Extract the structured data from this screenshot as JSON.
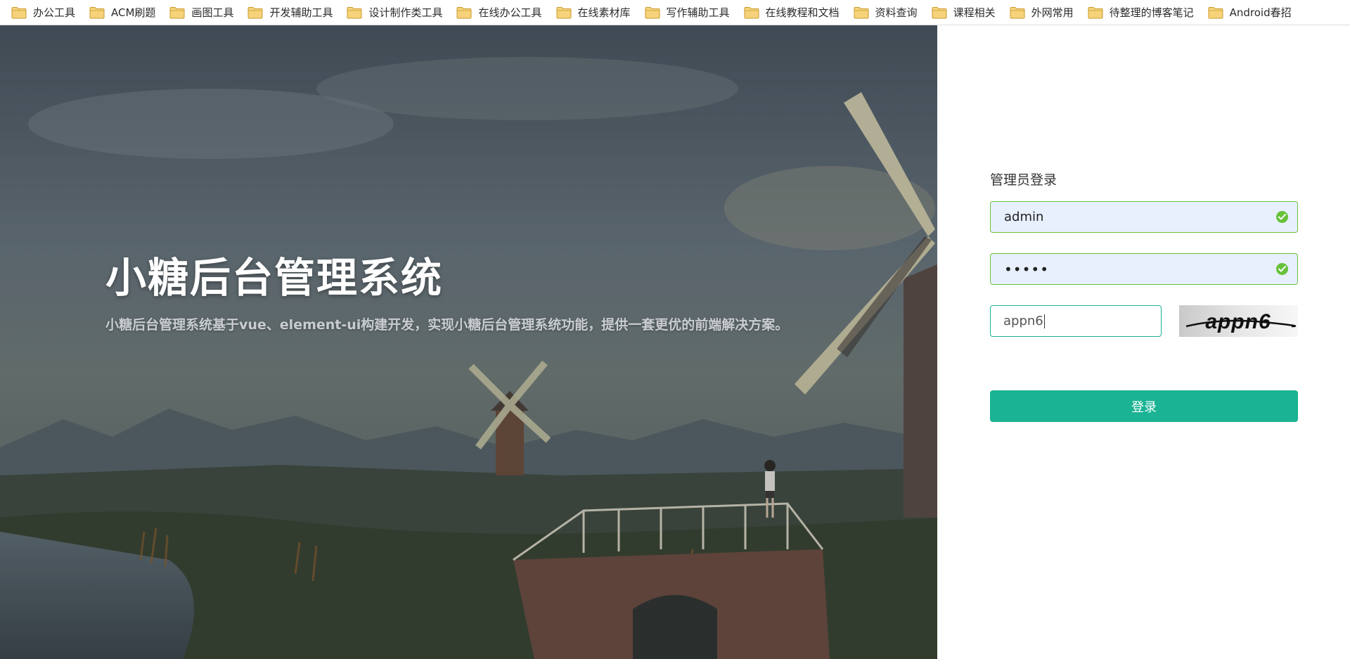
{
  "bookmarks": [
    {
      "label": "办公工具"
    },
    {
      "label": "ACM刷题"
    },
    {
      "label": "画图工具"
    },
    {
      "label": "开发辅助工具"
    },
    {
      "label": "设计制作类工具"
    },
    {
      "label": "在线办公工具"
    },
    {
      "label": "在线素材库"
    },
    {
      "label": "写作辅助工具"
    },
    {
      "label": "在线教程和文档"
    },
    {
      "label": "资料查询"
    },
    {
      "label": "课程相关"
    },
    {
      "label": "外网常用"
    },
    {
      "label": "待整理的博客笔记"
    },
    {
      "label": "Android春招"
    }
  ],
  "hero": {
    "title": "小糖后台管理系统",
    "description": "小糖后台管理系统基于vue、element-ui构建开发，实现小糖后台管理系统功能，提供一套更优的前端解决方案。"
  },
  "login": {
    "title": "管理员登录",
    "username": "admin",
    "password_mask": "•••••",
    "captcha_value": "appn6",
    "captcha_image_text": "appn6",
    "submit_label": "登录"
  },
  "colors": {
    "primary": "#1ab394",
    "valid": "#67c23a",
    "autofill_bg": "#e8f0fe"
  },
  "icons": {
    "bookmark": "folder-icon",
    "validated": "check-circle-icon"
  }
}
